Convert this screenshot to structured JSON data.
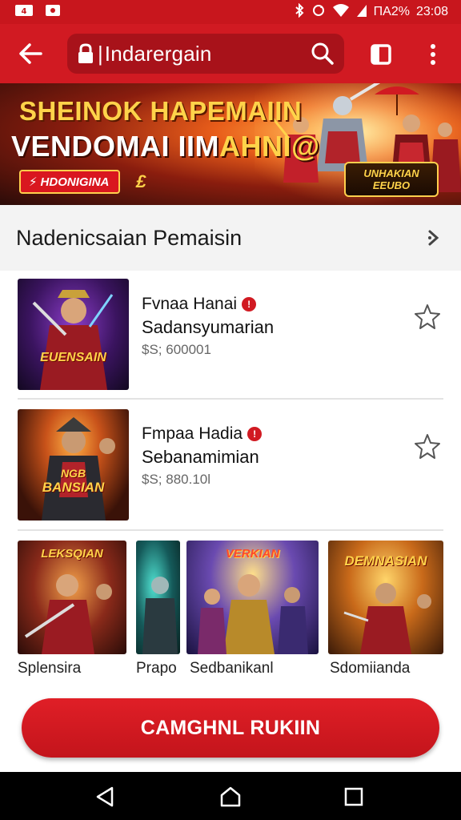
{
  "status_bar": {
    "left_icons": [
      "app-icon",
      "app-icon"
    ],
    "battery_text": "ΠΑ2%",
    "time": "23:08"
  },
  "toolbar": {
    "url": "Indarergain",
    "icons": [
      "back-arrow-icon",
      "lock-icon",
      "search-icon",
      "tabs-icon",
      "more-vert-icon"
    ]
  },
  "banner": {
    "title_line1": "SHEINOK HAPEMAIIN",
    "title_line2_a": "VENDOMAI IIM",
    "title_line2_b": "AHNI@",
    "tag": "HDONIGINA",
    "tag_extra": "£",
    "logo_line1": "UNHAKIAN",
    "logo_line2": "EEUBO"
  },
  "section": {
    "title": "Nadenicsaian Pemaisin"
  },
  "list_items": [
    {
      "title": "Fvnaa Hanai",
      "subtitle": "Sadansyumarian",
      "price": "$S; 600001",
      "thumb_logo": "EUENSAIN",
      "badge": "!"
    },
    {
      "title": "Fmpaa Hadia",
      "subtitle": "Sebanamimian",
      "price": "$S; 880.10l",
      "thumb_logo": "BANSIAN",
      "thumb_logo_top": "NGB",
      "badge": "!"
    }
  ],
  "grid": [
    {
      "label": "Splensira",
      "logo": "LEKSQIAN"
    },
    {
      "label": "Prapo",
      "logo": ""
    },
    {
      "label": "Sedbanikanl",
      "logo": "VERKIAN"
    },
    {
      "label": "Sdomiianda",
      "logo": "DEMNASIAN"
    }
  ],
  "cta": {
    "label": "CAMGHNL RUKIIN"
  },
  "colors": {
    "brand_red": "#d11a22",
    "dark_red": "#a8121a",
    "accent_gold": "#ffd34a"
  }
}
